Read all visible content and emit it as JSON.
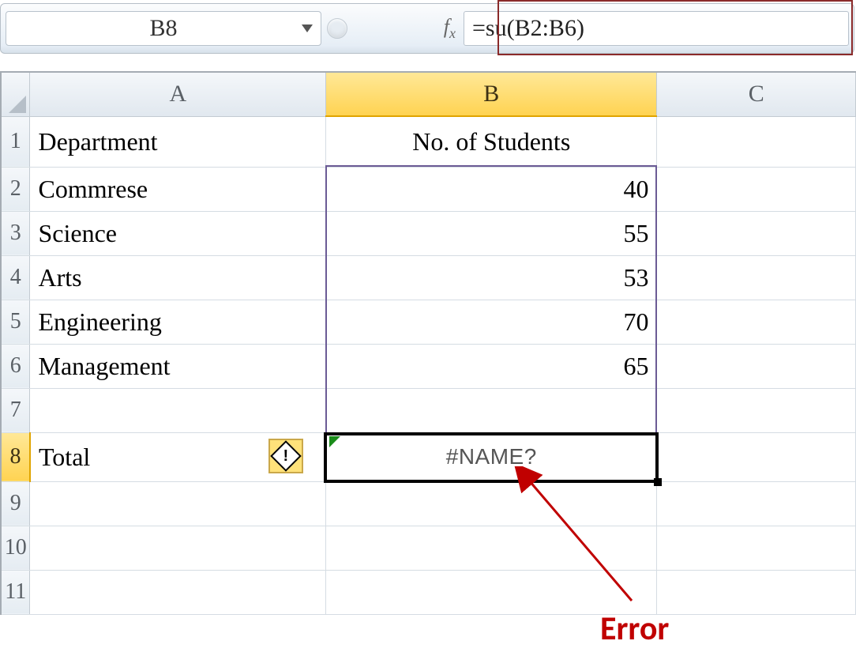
{
  "formula_bar": {
    "name_box": "B8",
    "fx_label": "fx",
    "formula": "=su(B2:B6)"
  },
  "columns": {
    "A": "A",
    "B": "B",
    "C": "C"
  },
  "rows": [
    "1",
    "2",
    "3",
    "4",
    "5",
    "6",
    "7",
    "8",
    "9",
    "10",
    "11"
  ],
  "header": {
    "A": "Department",
    "B": "No. of Students"
  },
  "data": [
    {
      "dept": "Commrese",
      "count": "40"
    },
    {
      "dept": "Science",
      "count": "55"
    },
    {
      "dept": "Arts",
      "count": "53"
    },
    {
      "dept": "Engineering",
      "count": "70"
    },
    {
      "dept": "Management",
      "count": "65"
    }
  ],
  "totals": {
    "label": "Total",
    "value": "#NAME?"
  },
  "smarttag_icon": "!",
  "annotation": "Error",
  "active_cell": "B8",
  "selected_range": "B2:B7"
}
